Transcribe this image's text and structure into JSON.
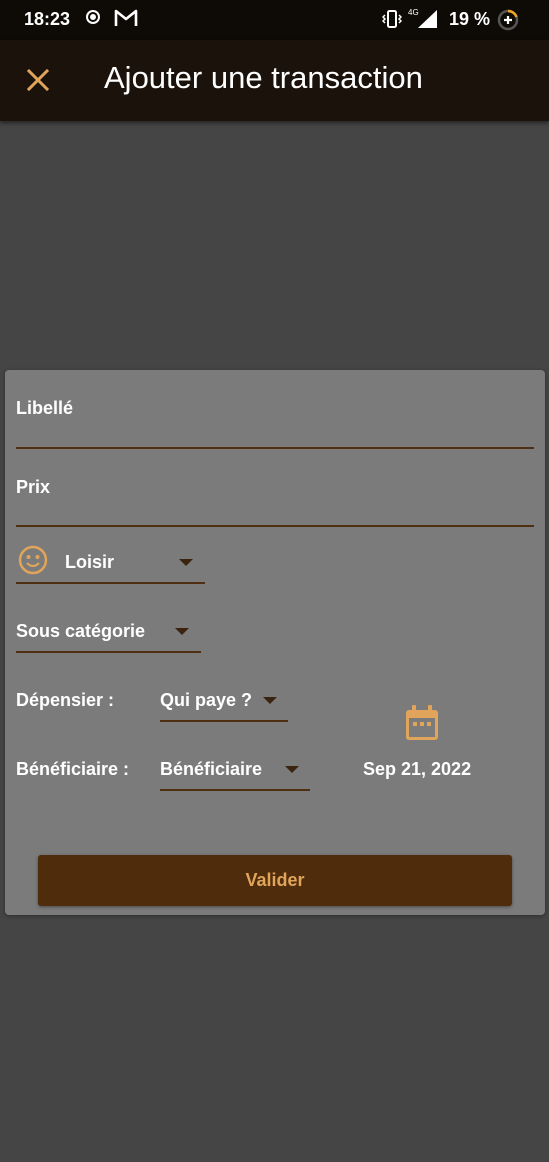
{
  "status_bar": {
    "time": "18:23",
    "network": "4G",
    "battery": "19 %"
  },
  "app_bar": {
    "title": "Ajouter une transaction",
    "close_icon": "close-icon"
  },
  "form": {
    "label_field": {
      "label": "Libellé",
      "value": ""
    },
    "price_field": {
      "label": "Prix",
      "value": ""
    },
    "category": {
      "selected": "Loisir",
      "icon": "smiley-icon"
    },
    "subcategory": {
      "placeholder": "Sous catégorie"
    },
    "spender": {
      "label": "Dépensier :",
      "selected": "Qui paye ?"
    },
    "beneficiary": {
      "label": "Bénéficiaire :",
      "selected": "Bénéficiaire"
    },
    "date": {
      "value": "Sep 21, 2022",
      "icon": "calendar-icon"
    },
    "submit_label": "Valider"
  },
  "colors": {
    "accent": "#e0a45a",
    "underline": "#4f2f11",
    "button_bg": "#4e2c0c",
    "card_bg": "#7b7b7b",
    "page_bg": "#454545",
    "app_bar_bg": "#1b130b"
  }
}
